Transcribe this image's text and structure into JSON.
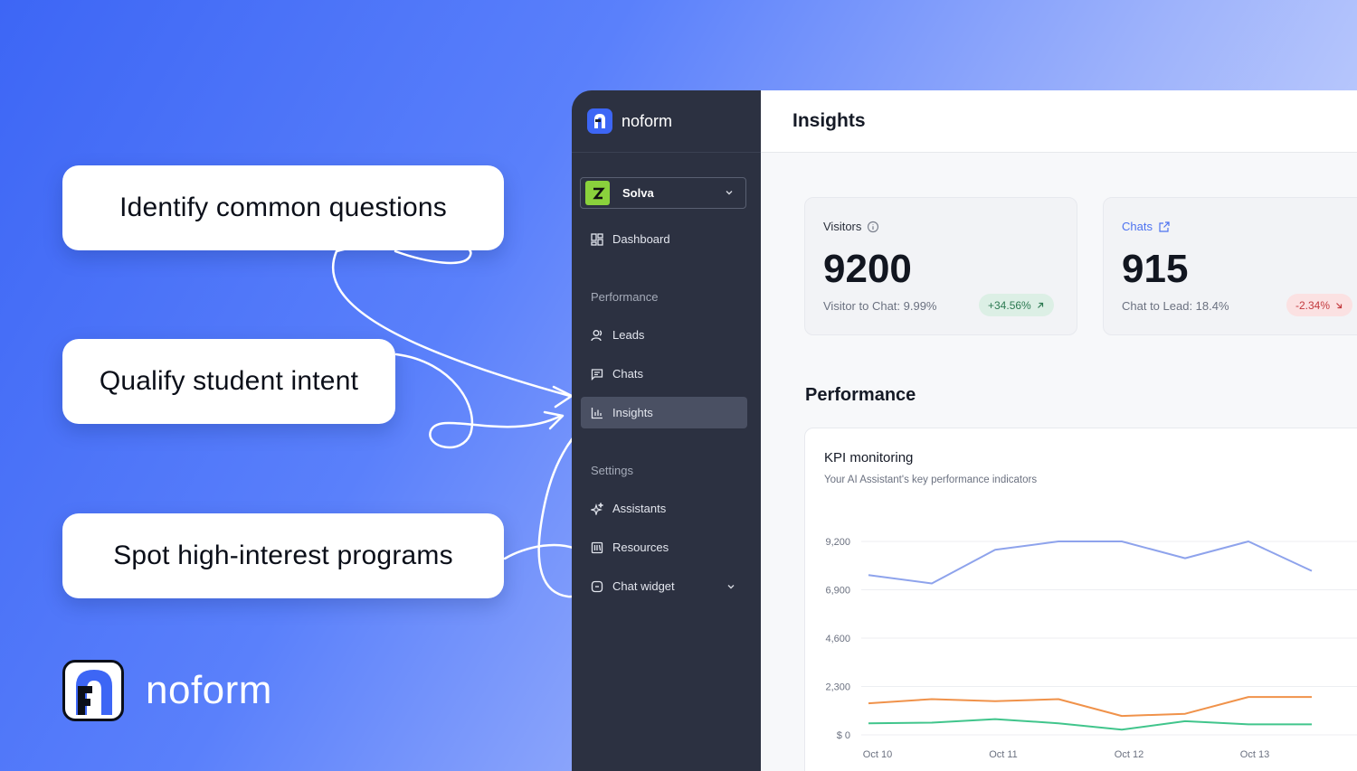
{
  "callouts": {
    "c1": "Identify common questions",
    "c2": "Qualify student intent",
    "c3": "Spot high-interest programs"
  },
  "brand": {
    "name": "noform"
  },
  "app": {
    "logo_text": "noform",
    "workspace": "Solva",
    "nav": {
      "dashboard": "Dashboard",
      "section_performance": "Performance",
      "leads": "Leads",
      "chats": "Chats",
      "insights": "Insights",
      "section_settings": "Settings",
      "assistants": "Assistants",
      "resources": "Resources",
      "chat_widget": "Chat widget"
    },
    "page_title": "Insights",
    "cards": {
      "visitors": {
        "label": "Visitors",
        "value": "9200",
        "sub": "Visitor to Chat: 9.99%",
        "change": "+34.56%"
      },
      "chats": {
        "label": "Chats",
        "value": "915",
        "sub": "Chat to Lead: 18.4%",
        "change": "-2.34%"
      }
    },
    "performance_title": "Performance",
    "kpi": {
      "title": "KPI monitoring",
      "subtitle": "Your AI Assistant's key performance indicators"
    }
  },
  "colors": {
    "accent": "#3d66f5",
    "sidebar": "#2c3141",
    "up": "#2d7a52",
    "down": "#c33b3f"
  },
  "chart_data": {
    "type": "line",
    "y_ticks": [
      "9,200",
      "6,900",
      "4,600",
      "2,300",
      "$ 0"
    ],
    "ylim": [
      0,
      9200
    ],
    "x_ticks": [
      "Oct 10",
      "Oct 11",
      "Oct 12",
      "Oct 13"
    ],
    "series": [
      {
        "color": "#8ea3ec",
        "values": [
          7600,
          7200,
          8800,
          9200,
          9200,
          8400,
          9200,
          7800
        ]
      },
      {
        "color": "#f0924a",
        "values": [
          1500,
          1700,
          1600,
          1700,
          900,
          1000,
          1800,
          1800
        ]
      },
      {
        "color": "#41c58c",
        "values": [
          550,
          580,
          750,
          550,
          250,
          650,
          500,
          500
        ]
      }
    ]
  }
}
